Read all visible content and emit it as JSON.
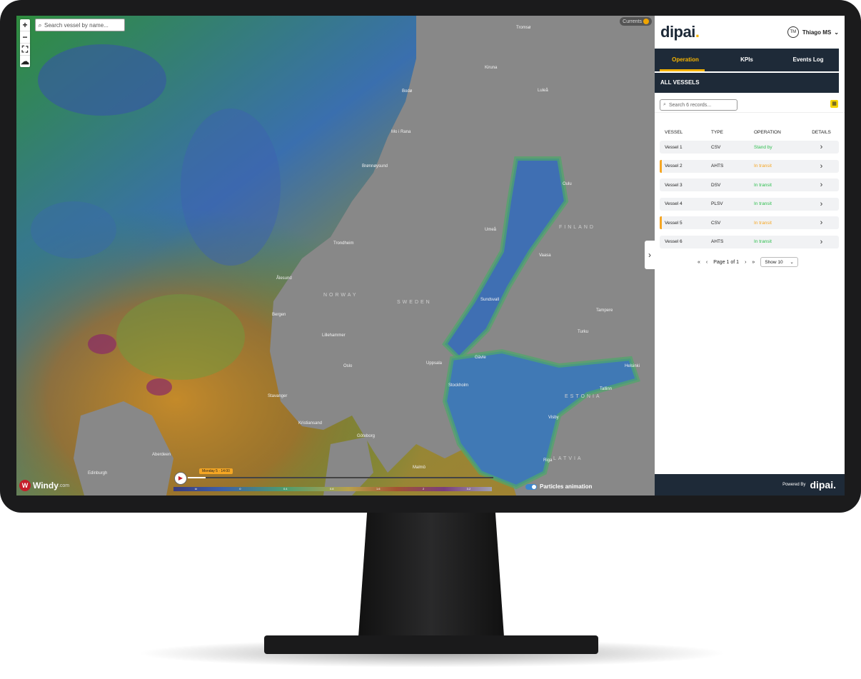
{
  "map": {
    "search_placeholder": "Search vessel by name...",
    "currents_label": "Currents",
    "zoom_in": "+",
    "zoom_out": "−",
    "windy_brand": "Windy",
    "windy_suffix": ".com",
    "time_label": "Monday 5 · 14:00",
    "particles_label": "Particles animation",
    "scale_ticks": [
      "kt",
      "0",
      "0.4",
      "0.8",
      "1.6",
      "2",
      "3.2"
    ],
    "countries": [
      "NORWAY",
      "SWEDEN",
      "FINLAND",
      "ESTONIA",
      "LATVIA"
    ],
    "places": [
      "Bodø",
      "Mo i Rana",
      "Brønnøysund",
      "Trondheim",
      "Ålesund",
      "Bergen",
      "Stavanger",
      "Kristiansand",
      "Oslo",
      "Lillehammer",
      "Göteborg",
      "Stockholm",
      "Uppsala",
      "Umeå",
      "Oulu",
      "Helsinki",
      "Tallinn",
      "Riga",
      "Aberdeen",
      "Edinburgh",
      "Tromsø",
      "Kiruna",
      "Luleå",
      "Vaasa",
      "Turku",
      "Tampere",
      "Gävle",
      "Sundsvall",
      "Malmö",
      "Visby"
    ]
  },
  "panel": {
    "logo_text": "dipai",
    "logo_dot": ".",
    "user": {
      "initials": "TM",
      "name": "Thiago MS",
      "caret": "⌄"
    },
    "tabs": [
      {
        "label": "Operation",
        "active": true
      },
      {
        "label": "KPIs",
        "active": false
      },
      {
        "label": "Events Log",
        "active": false
      }
    ],
    "section_title": "ALL VESSELS",
    "search_placeholder": "Search 6 records...",
    "columns": [
      "VESSEL",
      "TYPE",
      "OPERATION",
      "DETAILS"
    ],
    "vessels": [
      {
        "name": "Vessel 1",
        "type": "CSV",
        "operation": "Stand by",
        "status": "green",
        "flag": false
      },
      {
        "name": "Vessel 2",
        "type": "AHTS",
        "operation": "In transit",
        "status": "orange",
        "flag": true
      },
      {
        "name": "Vessel 3",
        "type": "DSV",
        "operation": "In transit",
        "status": "green",
        "flag": false
      },
      {
        "name": "Vessel 4",
        "type": "PLSV",
        "operation": "In transit",
        "status": "green",
        "flag": false
      },
      {
        "name": "Vessel 5",
        "type": "CSV",
        "operation": "In transit",
        "status": "orange",
        "flag": true
      },
      {
        "name": "Vessel 6",
        "type": "AHTS",
        "operation": "In transit",
        "status": "green",
        "flag": false
      }
    ],
    "pager": {
      "first": "«",
      "prev": "‹",
      "page_text": "Page 1 of 1",
      "next": "›",
      "last": "»",
      "show": "Show 10"
    },
    "footer": {
      "powered_by": "Powered By",
      "logo": "dipai."
    },
    "colors": {
      "navy": "#1e2a38",
      "accent": "#f5b300",
      "green": "#2fbf4f",
      "orange": "#f5a623"
    }
  }
}
